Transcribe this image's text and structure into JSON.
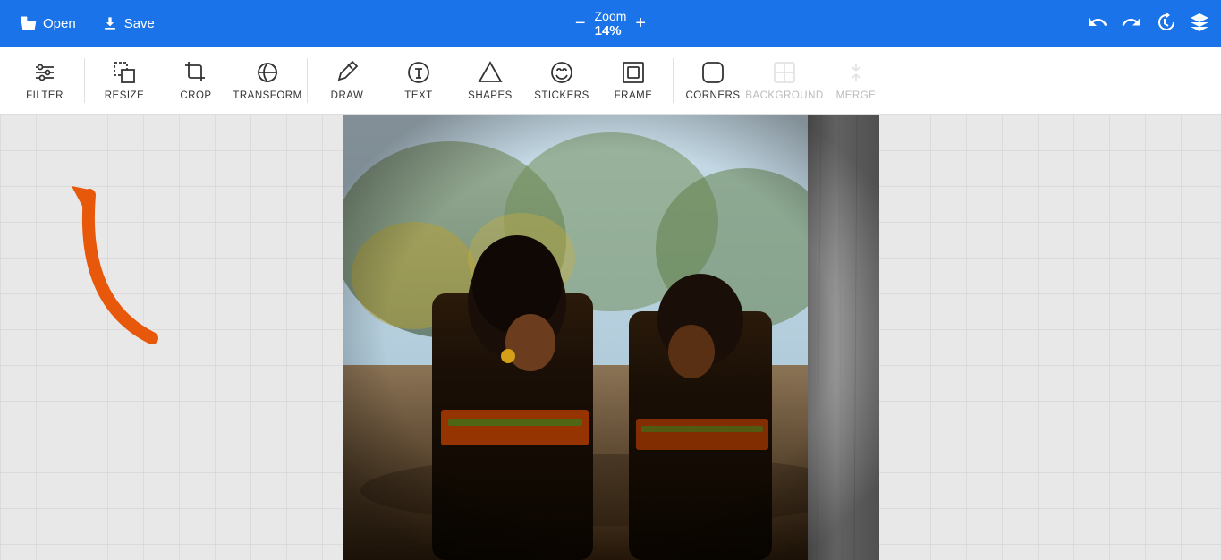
{
  "topbar": {
    "open_label": "Open",
    "save_label": "Save",
    "zoom_label": "Zoom",
    "zoom_value": "14%",
    "zoom_minus": "−",
    "zoom_plus": "+"
  },
  "toolbar": {
    "items": [
      {
        "id": "filter",
        "label": "FILTER",
        "enabled": true
      },
      {
        "id": "resize",
        "label": "RESIZE",
        "enabled": true
      },
      {
        "id": "crop",
        "label": "CROP",
        "enabled": true
      },
      {
        "id": "transform",
        "label": "TRANSFORM",
        "enabled": true
      },
      {
        "id": "draw",
        "label": "DRAW",
        "enabled": true
      },
      {
        "id": "text",
        "label": "TEXT",
        "enabled": true
      },
      {
        "id": "shapes",
        "label": "SHAPES",
        "enabled": true
      },
      {
        "id": "stickers",
        "label": "STICKERS",
        "enabled": true
      },
      {
        "id": "frame",
        "label": "FRAME",
        "enabled": true
      },
      {
        "id": "corners",
        "label": "CORNERS",
        "enabled": true
      },
      {
        "id": "background",
        "label": "BACKGROUND",
        "enabled": false
      },
      {
        "id": "merge",
        "label": "MERGE",
        "enabled": false
      }
    ]
  },
  "colors": {
    "topbar_bg": "#1a73e8",
    "arrow_color": "#e8580a"
  }
}
